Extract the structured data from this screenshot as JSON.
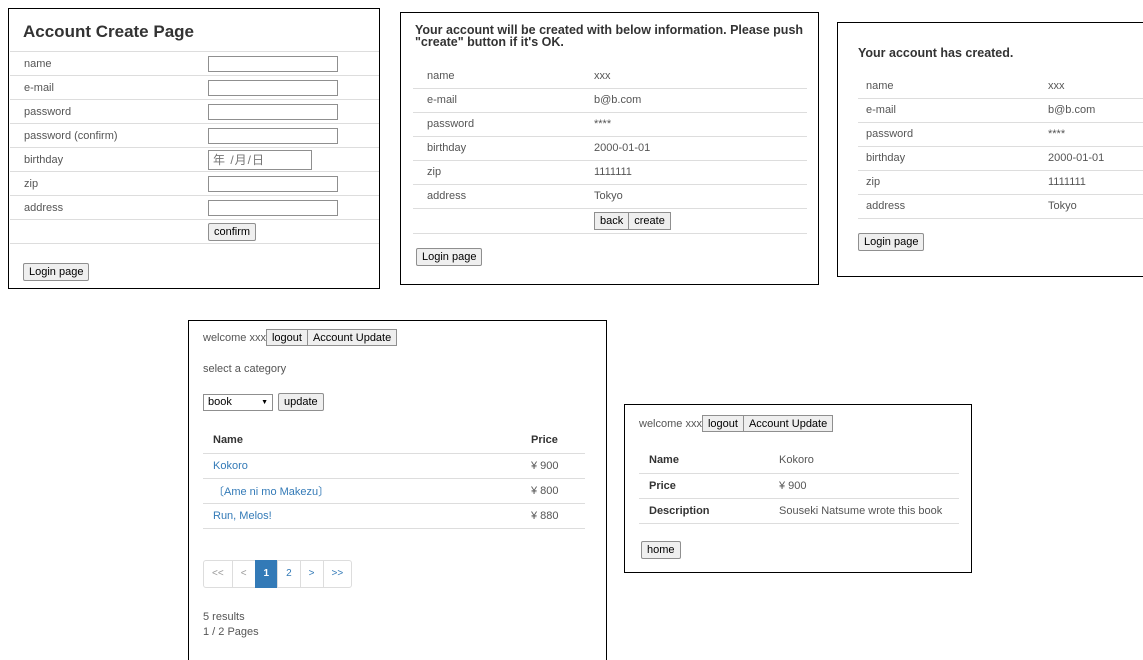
{
  "create_form": {
    "title": "Account Create Page",
    "fields": [
      "name",
      "e-mail",
      "password",
      "password (confirm)",
      "birthday",
      "zip",
      "address"
    ],
    "birthday_placeholder": "年 /月/日",
    "confirm_label": "confirm",
    "login_label": "Login page"
  },
  "confirm_page": {
    "title": "Your account will be created with below information. Please push \"create\" button if it's OK.",
    "rows": [
      {
        "label": "name",
        "value": "xxx"
      },
      {
        "label": "e-mail",
        "value": "b@b.com"
      },
      {
        "label": "password",
        "value": "****"
      },
      {
        "label": "birthday",
        "value": "2000-01-01"
      },
      {
        "label": "zip",
        "value": "1111111"
      },
      {
        "label": "address",
        "value": "Tokyo"
      }
    ],
    "back_label": "back",
    "create_label": "create",
    "login_label": "Login page"
  },
  "created_page": {
    "title": "Your account has created.",
    "rows": [
      {
        "label": "name",
        "value": "xxx"
      },
      {
        "label": "e-mail",
        "value": "b@b.com"
      },
      {
        "label": "password",
        "value": "****"
      },
      {
        "label": "birthday",
        "value": "2000-01-01"
      },
      {
        "label": "zip",
        "value": "1111111"
      },
      {
        "label": "address",
        "value": "Tokyo"
      }
    ],
    "login_label": "Login page"
  },
  "list_page": {
    "welcome": "welcome xxx",
    "logout_label": "logout",
    "account_update_label": "Account Update",
    "select_label": "select a category",
    "category_selected": "book",
    "update_label": "update",
    "headers": {
      "name": "Name",
      "price": "Price"
    },
    "items": [
      {
        "name": "Kokoro",
        "price": "¥ 900"
      },
      {
        "name": "〔Ame ni mo Makezu〕",
        "price": "¥ 800"
      },
      {
        "name": "Run, Melos!",
        "price": "¥ 880"
      }
    ],
    "pager": {
      "first": "<<",
      "prev": "<",
      "p1": "1",
      "p2": "2",
      "next": ">",
      "last": ">>",
      "current": 1
    },
    "results": "5 results",
    "pages": "1 / 2 Pages"
  },
  "detail_page": {
    "welcome": "welcome xxx",
    "logout_label": "logout",
    "account_update_label": "Account Update",
    "rows": [
      {
        "label": "Name",
        "value": "Kokoro"
      },
      {
        "label": "Price",
        "value": "¥ 900"
      },
      {
        "label": "Description",
        "value": "Souseki Natsume wrote this book"
      }
    ],
    "home_label": "home"
  },
  "colors": {
    "link": "#337ab7",
    "active_page": "#337ab7",
    "border": "#dddddd"
  }
}
